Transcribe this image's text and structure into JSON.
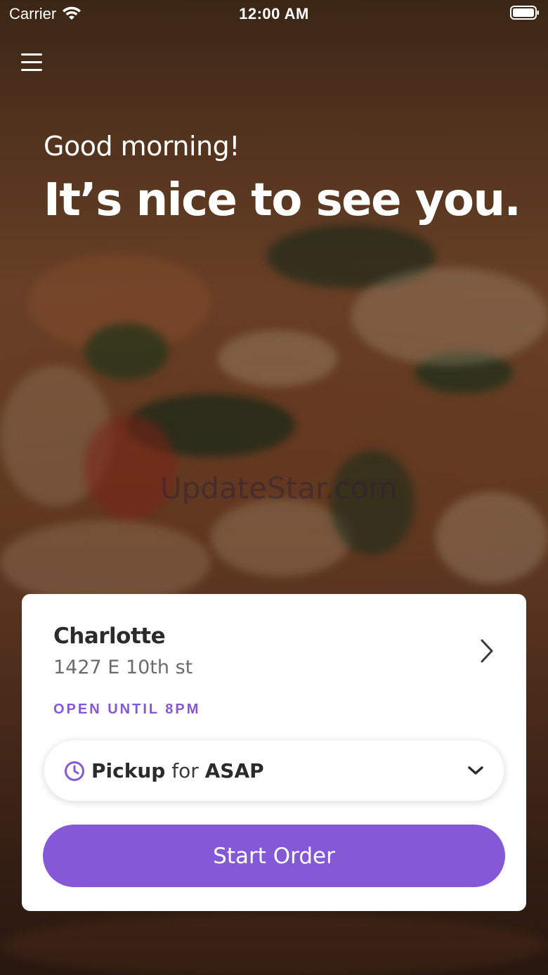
{
  "status_bar": {
    "carrier": "Carrier",
    "time": "12:00 AM"
  },
  "hero": {
    "greeting": "Good morning!",
    "headline": "It’s nice to see you."
  },
  "watermark": "UpdateStar.com",
  "location_card": {
    "store_name": "Charlotte",
    "address": "1427 E 10th st",
    "hours": "OPEN UNTIL 8PM",
    "order_mode": {
      "method": "Pickup",
      "connector": "for",
      "time": "ASAP"
    },
    "start_order_label": "Start Order"
  },
  "colors": {
    "accent": "#8458d6",
    "card_background": "#ffffff",
    "text_primary": "#2b2b2b",
    "text_secondary": "#6b6b6b"
  },
  "icons": {
    "menu": "hamburger-menu-icon",
    "location_chevron": "chevron-right-icon",
    "time": "clock-icon",
    "dropdown": "chevron-down-icon"
  }
}
